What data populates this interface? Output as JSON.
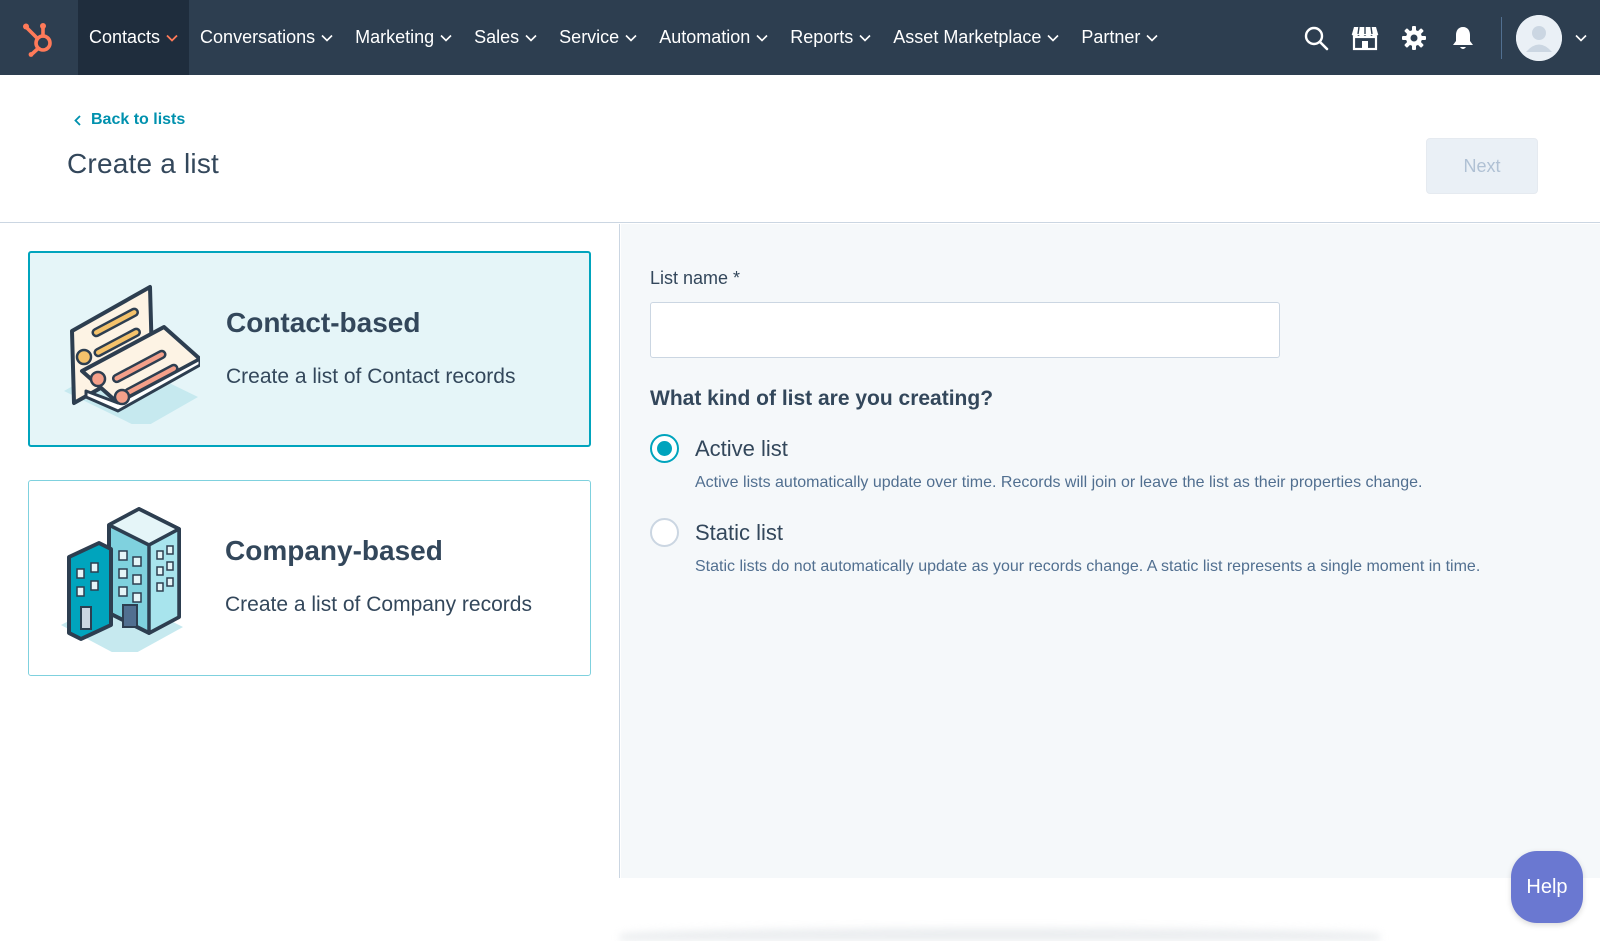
{
  "nav": {
    "items": [
      {
        "label": "Contacts",
        "active": true
      },
      {
        "label": "Conversations",
        "active": false
      },
      {
        "label": "Marketing",
        "active": false
      },
      {
        "label": "Sales",
        "active": false
      },
      {
        "label": "Service",
        "active": false
      },
      {
        "label": "Automation",
        "active": false
      },
      {
        "label": "Reports",
        "active": false
      },
      {
        "label": "Asset Marketplace",
        "active": false
      },
      {
        "label": "Partner",
        "active": false
      }
    ],
    "icons": [
      "search-icon",
      "marketplace-icon",
      "gear-icon",
      "bell-icon"
    ],
    "accent_color": "#ff7a59",
    "background_color": "#2d3e50"
  },
  "header": {
    "back_label": "Back to lists",
    "title": "Create a list",
    "next_label": "Next"
  },
  "list_types": [
    {
      "title": "Contact-based",
      "description": "Create a list of Contact records",
      "selected": true
    },
    {
      "title": "Company-based",
      "description": "Create a list of Company records",
      "selected": false
    }
  ],
  "form": {
    "list_name_label": "List name *",
    "list_name_value": "",
    "question": "What kind of list are you creating?",
    "options": [
      {
        "label": "Active list",
        "description": "Active lists automatically update over time. Records will join or leave the list as their properties change.",
        "checked": true
      },
      {
        "label": "Static list",
        "description": "Static lists do not automatically update as your records change. A static list represents a single moment in time.",
        "checked": false
      }
    ],
    "accent_color": "#00a4bd"
  },
  "help": {
    "label": "Help",
    "color": "#6a78d1"
  }
}
